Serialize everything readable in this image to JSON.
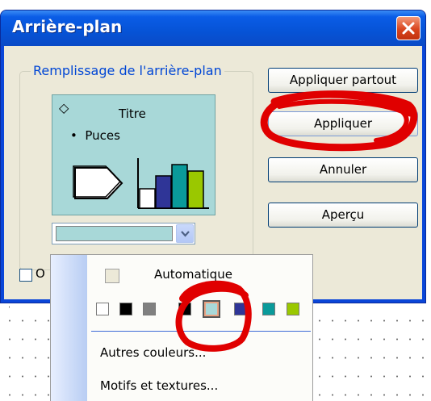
{
  "window": {
    "title": "Arrière-plan"
  },
  "group": {
    "legend": "Remplissage de l'arrière-plan"
  },
  "preview": {
    "title": "Titre",
    "bullet": "Puces"
  },
  "checkbox": {
    "label_partial": "O"
  },
  "buttons": {
    "apply_all": "Appliquer partout",
    "apply": "Appliquer",
    "cancel": "Annuler",
    "preview": "Aperçu"
  },
  "menu": {
    "automatic": "Automatique",
    "more_colors": "Autres couleurs...",
    "patterns": "Motifs et textures...",
    "swatches": [
      "#ffffff",
      "#000000",
      "#808080",
      "#000000",
      "#a8d8d8",
      "#2f3597",
      "#0a9a9a",
      "#9ac800"
    ],
    "selected_swatch": "#a8d8d8"
  },
  "colors": {
    "title_bar": "#0a5ce6",
    "preview_fill": "#a8d8d8",
    "annotation": "#e00000"
  }
}
